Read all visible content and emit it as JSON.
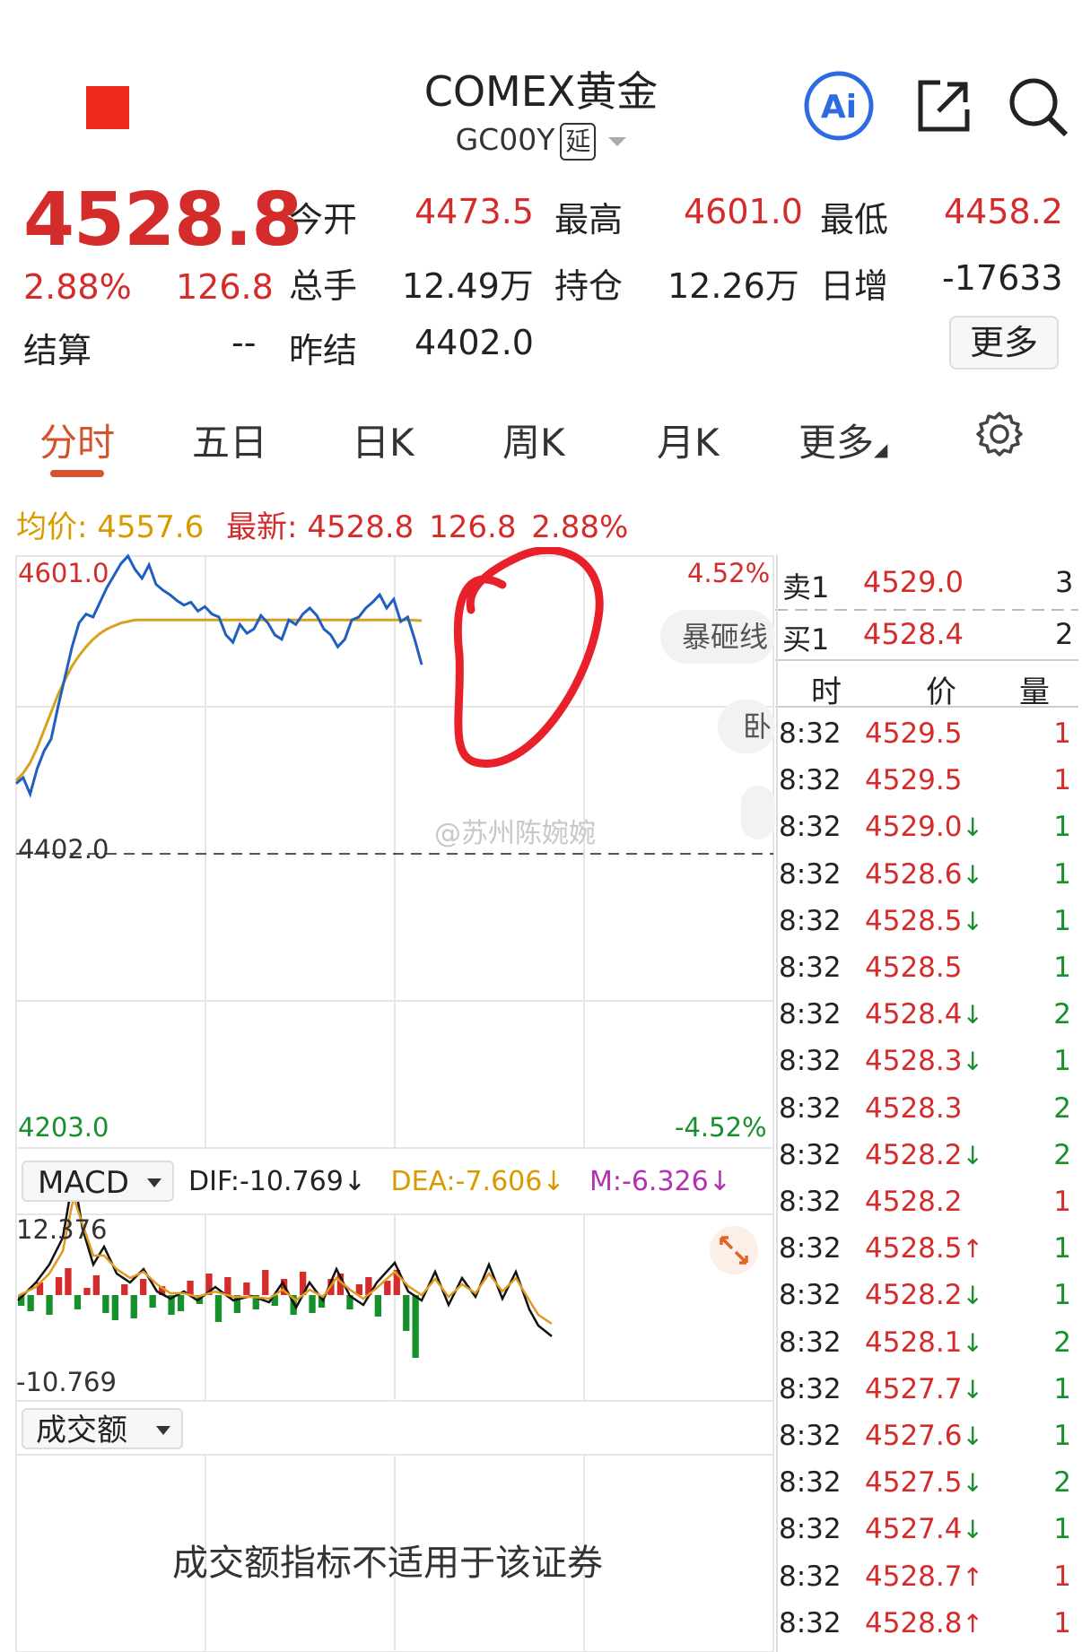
{
  "header": {
    "title": "COMEX黄金",
    "code": "GC00Y",
    "delay_tag": "延",
    "ai_label": "Ai"
  },
  "quote": {
    "last": "4528.8",
    "pct": "2.88%",
    "chg": "126.8",
    "settle_label": "结算",
    "settle_value": "--",
    "fields": [
      {
        "label": "今开",
        "value": "4473.5"
      },
      {
        "label": "最高",
        "value": "4601.0"
      },
      {
        "label": "最低",
        "value": "4458.2"
      },
      {
        "label": "总手",
        "value": "12.49万"
      },
      {
        "label": "持仓",
        "value": "12.26万"
      },
      {
        "label": "日增",
        "value": "-17633"
      },
      {
        "label": "昨结",
        "value": "4402.0"
      }
    ],
    "more_label": "更多"
  },
  "tabs": [
    "分时",
    "五日",
    "日K",
    "周K",
    "月K",
    "更多"
  ],
  "info": {
    "avg_label": "均价:",
    "avg_value": "4557.6",
    "latest_label": "最新:",
    "latest_value": "4528.8",
    "chg": "126.8",
    "pct": "2.88%"
  },
  "chart_data": {
    "type": "line",
    "y_top": "4601.0",
    "y_prev": "4402.0",
    "y_bottom": "4203.0",
    "pct_top": "4.52%",
    "pct_bottom": "-4.52%",
    "ylim": [
      4203.0,
      4601.0
    ],
    "series": [],
    "price_points": [
      4448,
      4452,
      4441,
      4458,
      4470,
      4478,
      4500,
      4520,
      4540,
      4556,
      4562,
      4560,
      4570,
      4580,
      4588,
      4596,
      4601,
      4592,
      4586,
      4595,
      4582,
      4578,
      4575,
      4571,
      4568,
      4570,
      4564,
      4567,
      4562,
      4560,
      4548,
      4543,
      4555,
      4549,
      4552,
      4561,
      4556,
      4548,
      4545,
      4558,
      4555,
      4562,
      4566,
      4561,
      4552,
      4548,
      4540,
      4545,
      4558,
      4560,
      4566,
      4570,
      4575,
      4566,
      4572,
      4557,
      4560,
      4545,
      4528
    ],
    "avg_points": [
      4450,
      4455,
      4462,
      4472,
      4484,
      4496,
      4508,
      4518,
      4527,
      4534,
      4540,
      4545,
      4549,
      4552,
      4554,
      4556,
      4557,
      4558,
      4558,
      4558,
      4558,
      4558,
      4558,
      4558,
      4558,
      4558,
      4558,
      4558,
      4558,
      4558,
      4558,
      4558,
      4558,
      4558,
      4558,
      4558,
      4558,
      4558,
      4558,
      4558,
      4558,
      4558,
      4558,
      4558,
      4558,
      4558,
      4558,
      4558,
      4558,
      4558,
      4558,
      4558,
      4558,
      4558,
      4558,
      4558,
      4558,
      4557.8,
      4557.6
    ]
  },
  "macd": {
    "selector": "MACD",
    "dif": "DIF:-10.769",
    "dea": "DEA:-7.606",
    "m": "M:-6.326",
    "arrow": "↓",
    "top": "12.376",
    "bottom": "-10.769"
  },
  "amount": {
    "selector": "成交额",
    "message": "成交额指标不适用于该证券"
  },
  "orderbook": {
    "sell1_label": "卖1",
    "sell1_price": "4529.0",
    "sell1_vol": "3",
    "buy1_label": "买1",
    "buy1_price": "4528.4",
    "buy1_vol": "2",
    "col_time": "时",
    "col_price": "价",
    "col_vol": "量"
  },
  "trades": [
    {
      "t": "8:32",
      "p": "4529.5",
      "a": "",
      "v": "1",
      "c": "red"
    },
    {
      "t": "8:32",
      "p": "4529.5",
      "a": "",
      "v": "1",
      "c": "red"
    },
    {
      "t": "8:32",
      "p": "4529.0",
      "a": "↓",
      "v": "1",
      "c": "green"
    },
    {
      "t": "8:32",
      "p": "4528.6",
      "a": "↓",
      "v": "1",
      "c": "green"
    },
    {
      "t": "8:32",
      "p": "4528.5",
      "a": "↓",
      "v": "1",
      "c": "green"
    },
    {
      "t": "8:32",
      "p": "4528.5",
      "a": "",
      "v": "1",
      "c": "green"
    },
    {
      "t": "8:32",
      "p": "4528.4",
      "a": "↓",
      "v": "2",
      "c": "green"
    },
    {
      "t": "8:32",
      "p": "4528.3",
      "a": "↓",
      "v": "1",
      "c": "green"
    },
    {
      "t": "8:32",
      "p": "4528.3",
      "a": "",
      "v": "2",
      "c": "green"
    },
    {
      "t": "8:32",
      "p": "4528.2",
      "a": "↓",
      "v": "2",
      "c": "green"
    },
    {
      "t": "8:32",
      "p": "4528.2",
      "a": "",
      "v": "1",
      "c": "red"
    },
    {
      "t": "8:32",
      "p": "4528.5",
      "a": "↑",
      "v": "1",
      "c": "green"
    },
    {
      "t": "8:32",
      "p": "4528.2",
      "a": "↓",
      "v": "1",
      "c": "green"
    },
    {
      "t": "8:32",
      "p": "4528.1",
      "a": "↓",
      "v": "2",
      "c": "green"
    },
    {
      "t": "8:32",
      "p": "4527.7",
      "a": "↓",
      "v": "1",
      "c": "green"
    },
    {
      "t": "8:32",
      "p": "4527.6",
      "a": "↓",
      "v": "1",
      "c": "green"
    },
    {
      "t": "8:32",
      "p": "4527.5",
      "a": "↓",
      "v": "2",
      "c": "green"
    },
    {
      "t": "8:32",
      "p": "4527.4",
      "a": "↓",
      "v": "1",
      "c": "green"
    },
    {
      "t": "8:32",
      "p": "4528.7",
      "a": "↑",
      "v": "1",
      "c": "red"
    },
    {
      "t": "8:32",
      "p": "4528.8",
      "a": "↑",
      "v": "1",
      "c": "red"
    }
  ],
  "overlay": {
    "pill1": "暴砸线",
    "pill2": "卧",
    "watermark": "@苏州陈婉婉"
  },
  "colors": {
    "up": "#d42b2b",
    "down": "#15902a",
    "price_line": "#1f5fbf",
    "avg_line": "#d9a21b",
    "highlight": "#e8202a"
  }
}
